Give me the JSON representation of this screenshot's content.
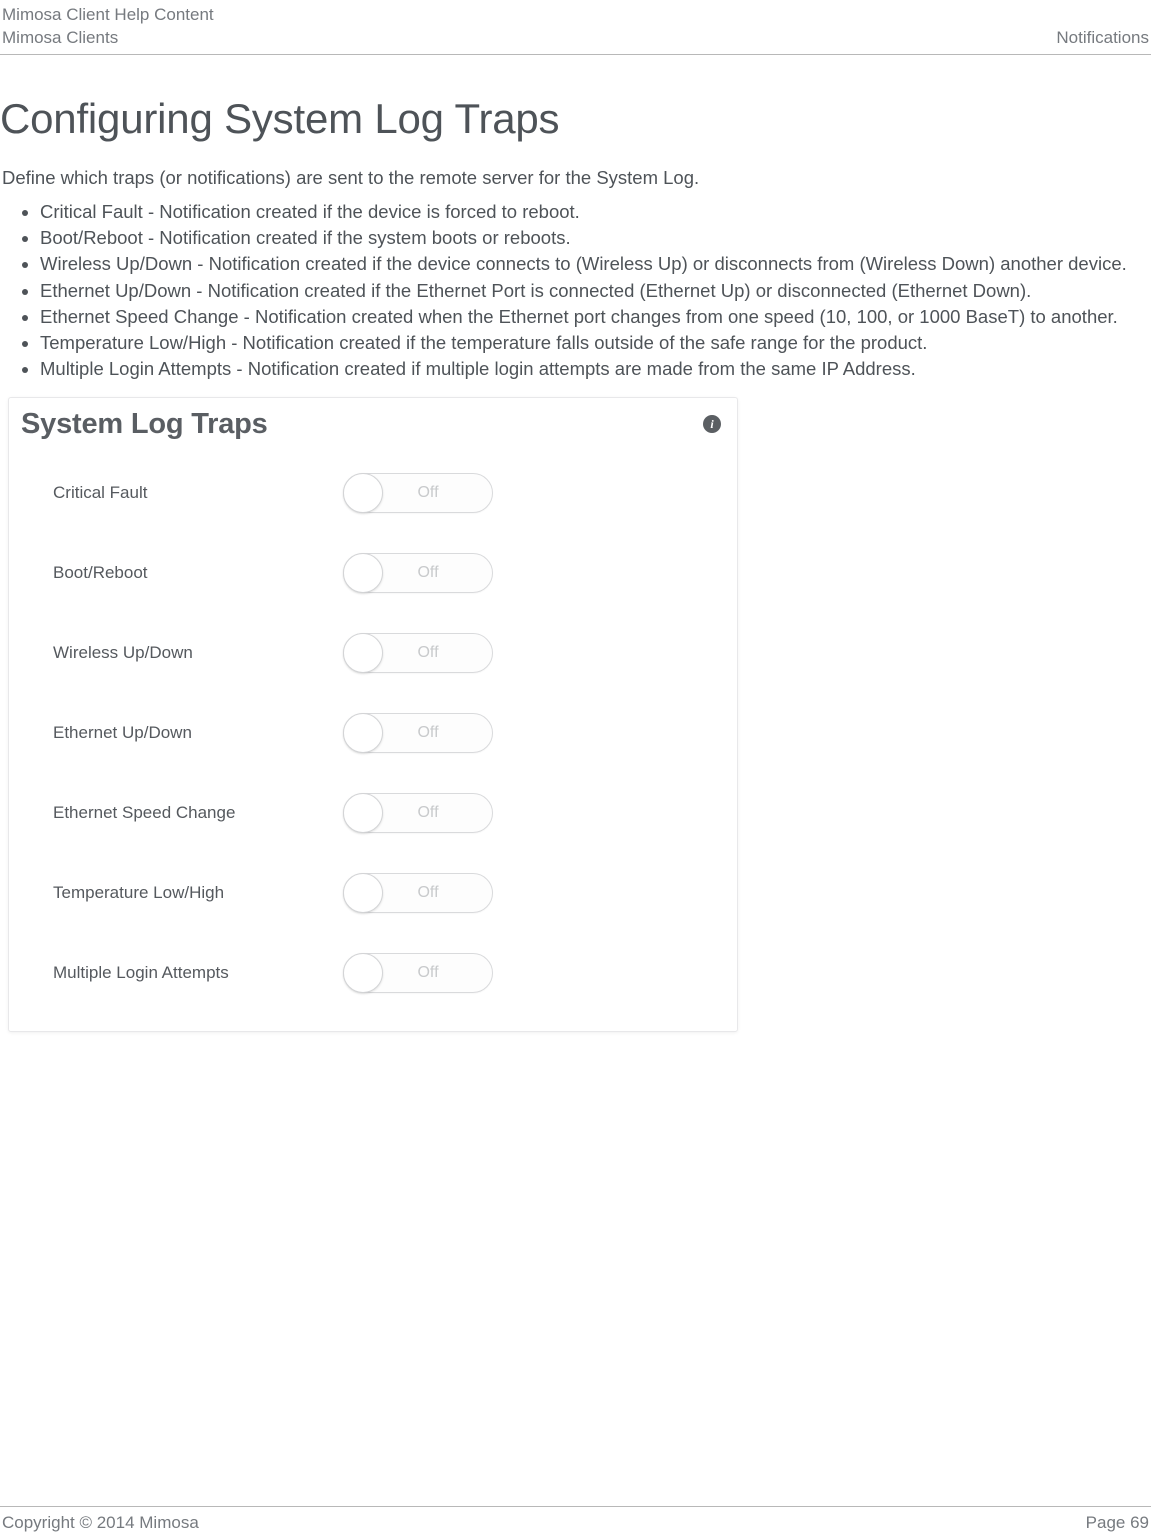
{
  "header": {
    "top_left": "Mimosa Client Help Content",
    "bottom_left": "Mimosa Clients",
    "bottom_right": "Notifications"
  },
  "title": "Configuring System Log Traps",
  "intro": "Define which traps (or notifications) are sent to the remote server for the System Log.",
  "bullets": [
    "Critical Fault - Notification created if the device is forced to reboot.",
    "Boot/Reboot - Notification created if the system boots or reboots.",
    "Wireless Up/Down - Notification created if the device connects to (Wireless Up) or disconnects from (Wireless Down) another device.",
    "Ethernet Up/Down - Notification created if the Ethernet Port is connected (Ethernet Up) or disconnected (Ethernet Down).",
    "Ethernet Speed Change - Notification created when the Ethernet port changes from one speed (10, 100, or 1000 BaseT) to another.",
    "Temperature Low/High - Notification created if the temperature falls outside of the safe range for the product.",
    "Multiple Login Attempts - Notification created if multiple login attempts are made from the same IP Address."
  ],
  "panel": {
    "title": "System Log Traps",
    "info_glyph": "i",
    "toggle_off_label": "Off",
    "rows": [
      {
        "label": "Critical Fault",
        "state": "Off"
      },
      {
        "label": "Boot/Reboot",
        "state": "Off"
      },
      {
        "label": "Wireless Up/Down",
        "state": "Off"
      },
      {
        "label": "Ethernet Up/Down",
        "state": "Off"
      },
      {
        "label": "Ethernet Speed Change",
        "state": "Off"
      },
      {
        "label": "Temperature Low/High",
        "state": "Off"
      },
      {
        "label": "Multiple Login Attempts",
        "state": "Off"
      }
    ]
  },
  "footer": {
    "left": "Copyright © 2014 Mimosa",
    "right": "Page 69"
  }
}
